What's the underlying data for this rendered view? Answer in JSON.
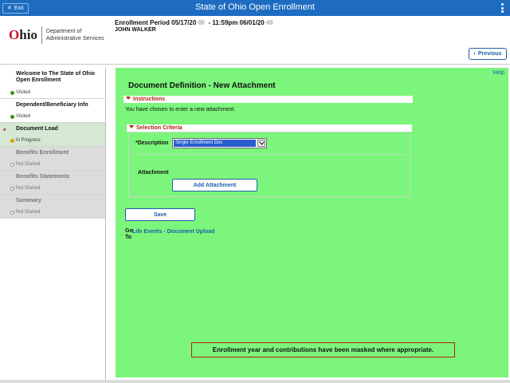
{
  "topbar": {
    "exit_label": "Exit",
    "title": "State of Ohio Open Enrollment",
    "color": "#1d6cc1"
  },
  "header": {
    "logo_text": "Ohio",
    "logo_dept_line1": "Department of",
    "logo_dept_line2": "Administrative Services",
    "enrollment_label": "Enrollment Period 05/17/20",
    "enrollment_mid": " - 11:59pm 06/01/20",
    "employee_name": "JOHN WALKER",
    "previous_label": "Previous"
  },
  "sidebar": {
    "items": [
      {
        "label": "Welcome to The State of Ohio Open Enrollment",
        "status": "Visited"
      },
      {
        "label": "Dependent/Beneficiary Info",
        "status": "Visited"
      },
      {
        "label": "Document Load",
        "status": "In Progress"
      },
      {
        "label": "Benefits Enrollment",
        "status": "Not Started"
      },
      {
        "label": "Benefits Statements",
        "status": "Not Started"
      },
      {
        "label": "Summary",
        "status": "Not Started"
      }
    ]
  },
  "main": {
    "help_label": "Help",
    "page_title": "Document Definition - New Attachment",
    "instructions_header": "Instructions",
    "instructions_text": "You have chosen to enter a new attachment.",
    "criteria_header": "Selection Criteria",
    "description_label": "*Description",
    "description_value": "Single Enrollment Doc",
    "attachment_label": "Attachment",
    "add_attachment_label": "Add Attachment",
    "save_label": "Save",
    "goto_label": "Go To",
    "goto_link": "Life Events - Document Upload",
    "masked_note": "Enrollment year and contributions have been masked where appropriate.",
    "background_color": "#7cf57c"
  }
}
